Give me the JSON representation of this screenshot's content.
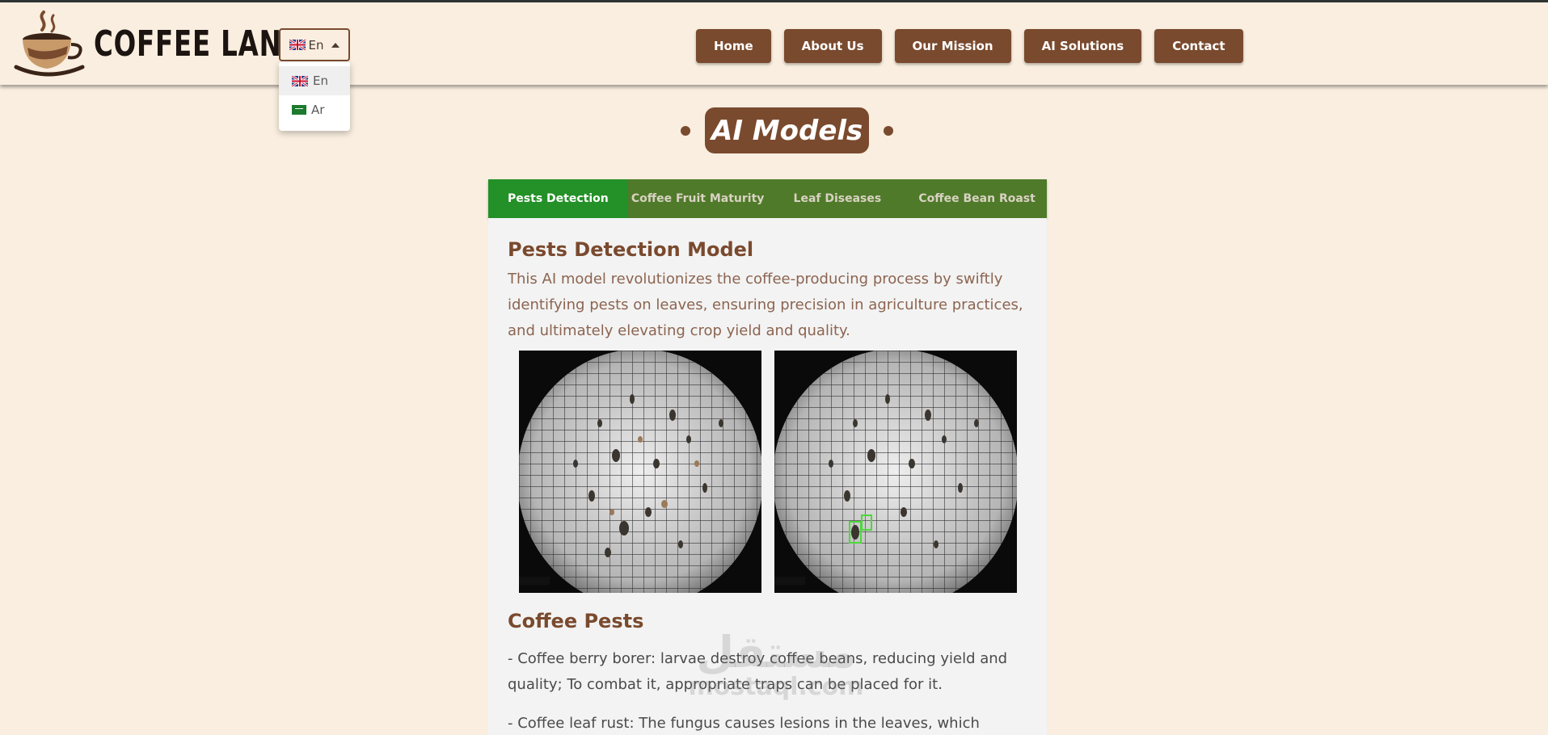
{
  "brand": {
    "name": "COFFEE LAND"
  },
  "language": {
    "current": "En",
    "options": [
      {
        "label": "En",
        "flag": "uk-flag-icon"
      },
      {
        "label": "Ar",
        "flag": "saudi-flag-icon"
      }
    ]
  },
  "nav": {
    "items": [
      "Home",
      "About Us",
      "Our Mission",
      "AI Solutions",
      "Contact"
    ]
  },
  "section": {
    "title": "AI Models"
  },
  "tabs": {
    "items": [
      "Pests Detection",
      "Coffee Fruit Maturity",
      "Leaf Diseases",
      "Coffee Bean Roast"
    ],
    "active_index": 0
  },
  "content": {
    "model_title": "Pests Detection Model",
    "model_description": "This AI model revolutionizes the coffee-producing process by swiftly identifying pests on leaves, ensuring precision in agriculture practices, and ultimately elevating crop yield and quality.",
    "pests_title": "Coffee Pests",
    "pests": [
      "- Coffee berry borer: larvae destroy coffee beans, reducing yield and quality; To combat it, appropriate traps can be placed for it.",
      "- Coffee leaf rust: The fungus causes lesions in the leaves, which"
    ]
  },
  "watermark": {
    "arabic": "مستقل",
    "latin": "mostaql.com"
  },
  "colors": {
    "page_bg": "#f9eedf",
    "brown": "#7a4a2e",
    "tab_bar": "#4f7a2a",
    "tab_active": "#239127",
    "card_bg": "#f3f3f3"
  }
}
